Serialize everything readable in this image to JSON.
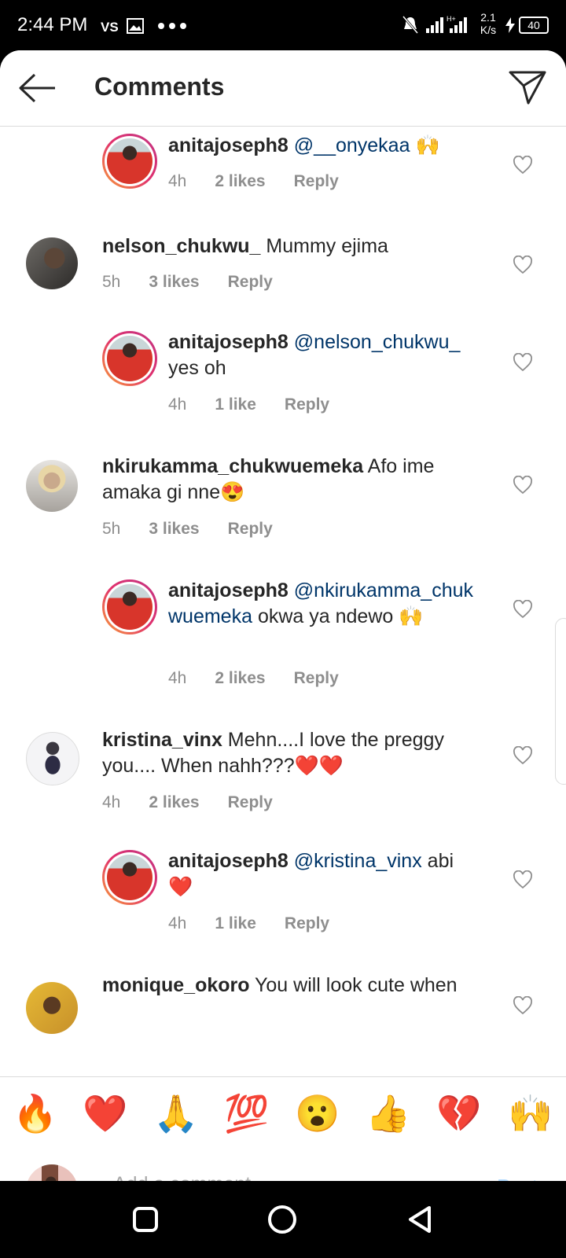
{
  "status_bar": {
    "time": "2:44 PM",
    "network_speed_top": "2.1",
    "network_speed_bottom": "K/s",
    "battery": "40"
  },
  "header": {
    "title": "Comments"
  },
  "comments": [
    {
      "user": "anitajoseph8",
      "mention": "@__onyekaa",
      "text": " 🙌",
      "time": "4h",
      "likes": "2 likes",
      "reply": "Reply",
      "reply_level": true
    },
    {
      "user": "nelson_chukwu_",
      "mention": "",
      "text": " Mummy ejima",
      "time": "5h",
      "likes": "3 likes",
      "reply": "Reply",
      "reply_level": false
    },
    {
      "user": "anitajoseph8",
      "mention": "@nelson_chukwu_",
      "text": "yes oh",
      "time": "4h",
      "likes": "1 like",
      "reply": "Reply",
      "reply_level": true
    },
    {
      "user": "nkirukamma_chukwuemeka",
      "mention": "",
      "text": " Afo ime amaka gi nne😍",
      "time": "5h",
      "likes": "3 likes",
      "reply": "Reply",
      "reply_level": false
    },
    {
      "user": "anitajoseph8",
      "mention": "@nkirukamma_chukwuemeka",
      "text": " okwa ya ndewo 🙌",
      "time": "4h",
      "likes": "2 likes",
      "reply": "Reply",
      "reply_level": true
    },
    {
      "user": "kristina_vinx",
      "mention": "",
      "text": " Mehn....I love the preggy you.... When nahh???❤️❤️",
      "time": "4h",
      "likes": "2 likes",
      "reply": "Reply",
      "reply_level": false
    },
    {
      "user": "anitajoseph8",
      "mention": "@kristina_vinx",
      "text": " abi ❤️",
      "time": "4h",
      "likes": "1 like",
      "reply": "Reply",
      "reply_level": true
    },
    {
      "user": "monique_okoro",
      "mention": "",
      "text": " You will look cute when",
      "time": "",
      "likes": "",
      "reply": "",
      "reply_level": false
    }
  ],
  "emoji_bar": [
    "🔥",
    "❤️",
    "🙏",
    "💯",
    "😮",
    "👍",
    "💔",
    "🙌"
  ],
  "composer": {
    "placeholder": "Add a comment...",
    "post_label": "Post"
  },
  "colors": {
    "accent": "#0095f6",
    "mention": "#003569",
    "muted": "#8e8e8e",
    "post_disabled": "#b3dbff"
  }
}
